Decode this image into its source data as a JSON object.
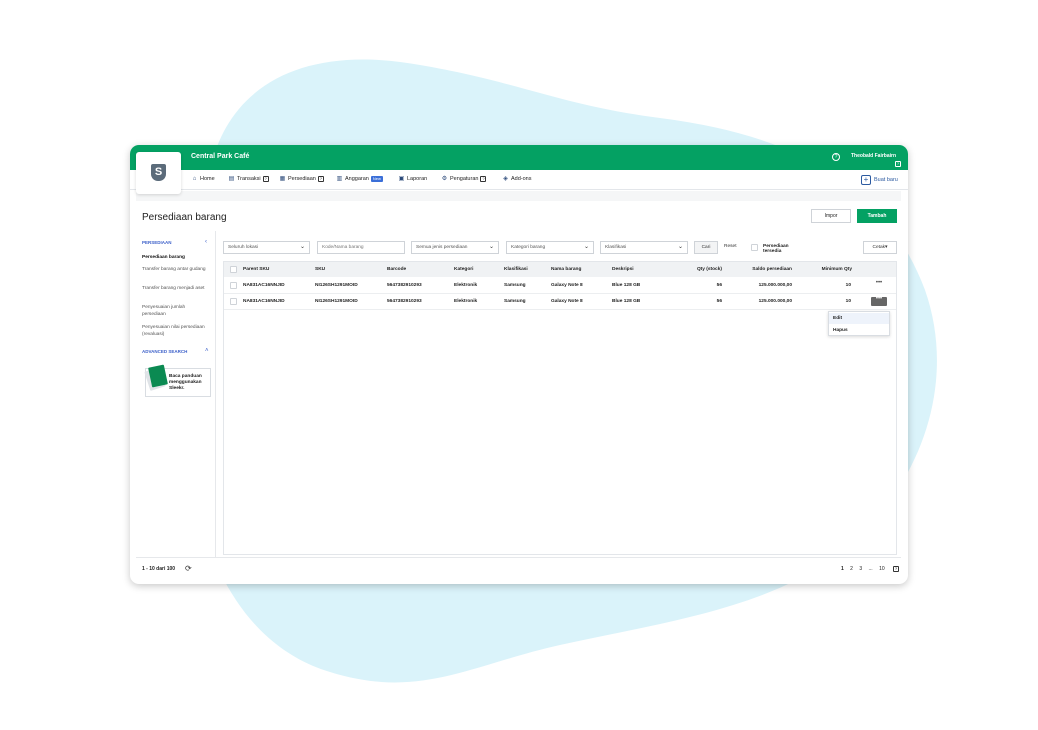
{
  "app": {
    "company": "Central Park Café",
    "user": "Theobald Fairbairn",
    "help": "?",
    "kbd": "?",
    "logo_letter": "S"
  },
  "nav": {
    "items": [
      {
        "label": "Home",
        "icon": "home-icon"
      },
      {
        "label": "Transaksi",
        "icon": "transaction-icon",
        "kbd": "?"
      },
      {
        "label": "Persediaan",
        "icon": "inventory-icon",
        "kbd": "?"
      },
      {
        "label": "Anggaran",
        "icon": "budget-icon",
        "badge": "New"
      },
      {
        "label": "Laporan",
        "icon": "report-icon"
      },
      {
        "label": "Pengaturan",
        "icon": "gear-icon",
        "kbd": "?"
      },
      {
        "label": "Add-ons",
        "icon": "tag-icon"
      }
    ],
    "create_label": "Buat baru",
    "create_icon": "+"
  },
  "page": {
    "title": "Persediaan barang",
    "impor": "Impor",
    "tambah": "Tambah"
  },
  "sidebar": {
    "heading": "PERSEDIAAN",
    "items": [
      "Persediaan barang",
      "Transfer barang antar gudang",
      "Transfer barang menjadi aset",
      "Penyesuaian jumlah persediaan",
      "Penyesuaian nilai persediaan (revaluasi)"
    ],
    "advanced": "ADVANCED SEARCH",
    "guide": "Baca panduan menggunakan Sleekr."
  },
  "filters": {
    "lokasi": "Seluruh lokasi",
    "kode_placeholder": "Kode/Nama barang",
    "jenis": "Semua jenis persediaan",
    "kategori": "Kategori barang",
    "klasifikasi": "Klasifikasi",
    "cari": "Cari",
    "reset": "Reset",
    "tersedia": "Persediaan tersedia",
    "cetak": "Cetak"
  },
  "table": {
    "columns": [
      "Parent SKU",
      "SKU",
      "Barcode",
      "Kategori",
      "Klasifikasi",
      "Nama barang",
      "Deskripsi",
      "Qty (stock)",
      "Saldo persediaan",
      "Minimum Qty"
    ],
    "rows": [
      {
        "parent_sku": "NA831AC16NNJID",
        "sku": "NI126SH1291MOID",
        "barcode": "5647382910293",
        "kategori": "Elektronik",
        "klasifikasi": "Samsung",
        "nama": "Galaxy Note 8",
        "deskripsi": "Blue 128 GB",
        "qty": "56",
        "saldo": "125.000.000,00",
        "min_qty": "10"
      },
      {
        "parent_sku": "NA831AC16NNJID",
        "sku": "NI126SH1291MOID",
        "barcode": "5647382910293",
        "kategori": "Elektronik",
        "klasifikasi": "Samsung",
        "nama": "Galaxy Note 8",
        "deskripsi": "Blue 128 GB",
        "qty": "56",
        "saldo": "125.000.000,00",
        "min_qty": "10"
      }
    ],
    "more": "•••",
    "menu": [
      "Edit",
      "Hapus"
    ]
  },
  "footer": {
    "info": "1 - 10 dari 100",
    "pages": [
      "1",
      "2",
      "3",
      "...",
      "10"
    ],
    "kbd": "?"
  },
  "colors": {
    "brand": "#04a163",
    "accent": "#3b6fd8",
    "blob": "#daf3fa"
  }
}
